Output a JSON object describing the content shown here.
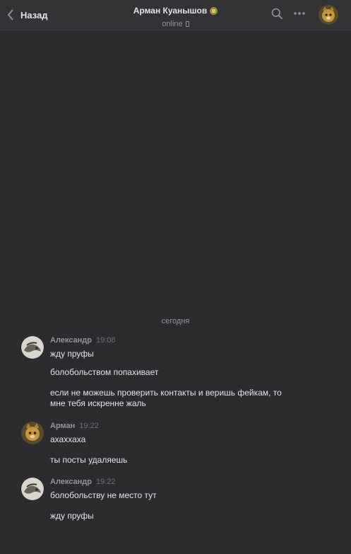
{
  "header": {
    "back_label": "Назад",
    "peer_name": "Арман Куанышов",
    "peer_status": "online",
    "icons": [
      "chevron-left-icon",
      "verified-crown-icon",
      "mobile-phone-icon",
      "search-icon",
      "more-icon"
    ]
  },
  "chat": {
    "date_separator": "сегодня",
    "groups": [
      {
        "author": "Александр",
        "time": "19:08",
        "messages": [
          "жду пруфы",
          "болобольством попахивает",
          "если не можешь проверить контакты и веришь фейкам, то мне тебя искренне жаль"
        ]
      },
      {
        "author": "Арман",
        "time": "19:22",
        "messages": [
          "ахаххаха",
          "ты посты удаляешь"
        ]
      },
      {
        "author": "Александр",
        "time": "19:22",
        "messages": [
          "болобольству не место тут",
          "жду пруфы"
        ]
      }
    ]
  },
  "colors": {
    "background": "#2c2c2f",
    "header": "#333336",
    "text": "#e1e3e6",
    "secondary_text": "#939699"
  }
}
